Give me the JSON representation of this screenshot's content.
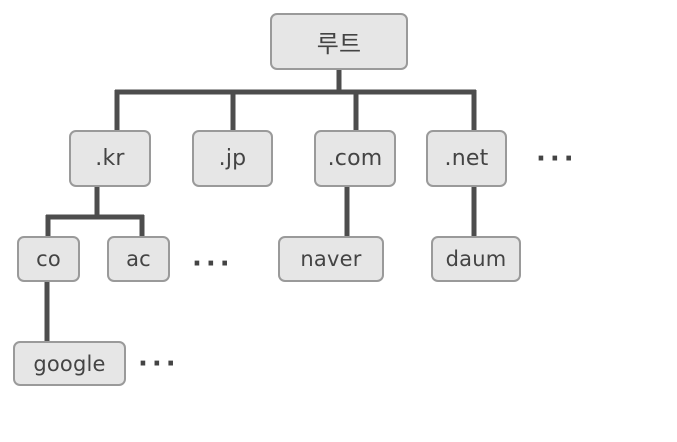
{
  "nodes": {
    "root": "루트",
    "kr": ".kr",
    "jp": ".jp",
    "com": ".com",
    "net": ".net",
    "co": "co",
    "ac": "ac",
    "naver": "naver",
    "daum": "daum",
    "google": "google"
  },
  "ellipsis": "···",
  "colors": {
    "node_fill": "#e6e6e6",
    "node_border": "#9a9a9a",
    "edge": "#4d4d4d",
    "text": "#444444"
  }
}
